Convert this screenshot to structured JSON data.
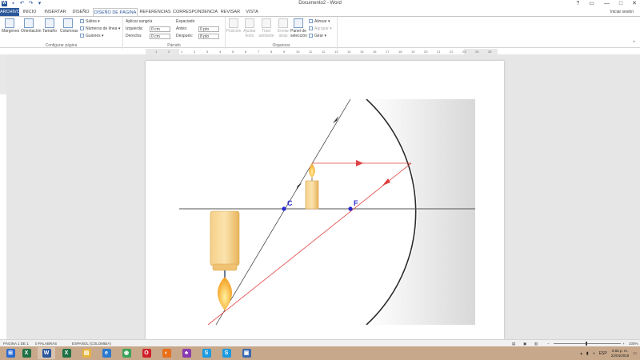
{
  "window": {
    "title": "Documento2 - Word",
    "sign_in": "Iniciar sesión",
    "help": "?",
    "restore": "▭",
    "minimize": "—",
    "maximize": "□",
    "close": "✕"
  },
  "quick_access": {
    "app_icon_label": "W",
    "save_icon": "save-icon",
    "undo_icon": "undo-icon",
    "redo_icon": "redo-icon",
    "customize_icon": "customize-icon"
  },
  "tabs": [
    {
      "label": "ARCHIVO"
    },
    {
      "label": "INICIO"
    },
    {
      "label": "INSERTAR"
    },
    {
      "label": "DISEÑO"
    },
    {
      "label": "DISEÑO DE PÁGINA"
    },
    {
      "label": "REFERENCIAS"
    },
    {
      "label": "CORRESPONDENCIA"
    },
    {
      "label": "REVISAR"
    },
    {
      "label": "VISTA"
    }
  ],
  "ribbon": {
    "page_setup": {
      "margins": "Márgenes",
      "orientation": "Orientación",
      "size": "Tamaño",
      "columns": "Columnas",
      "breaks": "Saltos",
      "line_numbers": "Números de línea",
      "hyphenation": "Guiones",
      "label": "Configurar página"
    },
    "paragraph": {
      "indent_header": "Aplicar sangría",
      "left_label": "Izquierda:",
      "left_value": "0 cm",
      "right_label": "Derecha:",
      "right_value": "0 cm",
      "spacing_header": "Espaciado",
      "before_label": "Antes:",
      "before_value": "0 pto",
      "after_label": "Después:",
      "after_value": "8 pto",
      "label": "Párrafo"
    },
    "arrange": {
      "position": "Posición",
      "wrap_text": "Ajustar texto",
      "bring_forward": "Traer adelante",
      "send_backward": "Enviar atrás",
      "selection_pane": "Panel de selección",
      "align": "Alinear",
      "group": "Agrupar",
      "rotate": "Girar",
      "label": "Organizar"
    }
  },
  "ruler": {
    "ticks": [
      "1",
      "2",
      "1",
      "2",
      "3",
      "4",
      "5",
      "6",
      "7",
      "8",
      "9",
      "10",
      "11",
      "12",
      "13",
      "14",
      "15",
      "16",
      "17",
      "18",
      "19",
      "20",
      "21",
      "22",
      "23",
      "24",
      "25"
    ]
  },
  "diagram": {
    "label_c": "C",
    "label_f": "F",
    "colors": {
      "mirror": "#2b2b2b",
      "axis": "#555555",
      "ray_red": "#e04040",
      "ray_dark": "#333333",
      "point": "#2a2ad0",
      "candle_body": "#f3c878",
      "candle_edge": "#d9a24a",
      "flame": "#f5a623"
    }
  },
  "statusbar": {
    "page": "PÁGINA 1 DE 1",
    "words": "0 PALABRAS",
    "language": "ESPAÑOL (COLOMBIA)",
    "zoom": "100%"
  },
  "taskbar": {
    "apps": [
      {
        "icon": "start-icon",
        "glyph": "⊞",
        "color": "#2a6ad0"
      },
      {
        "icon": "excel-icon",
        "glyph": "X",
        "color": "#1e7145"
      },
      {
        "icon": "word-icon",
        "glyph": "W",
        "color": "#2b579a"
      },
      {
        "icon": "excel-icon-2",
        "glyph": "X",
        "color": "#1e7145"
      },
      {
        "icon": "explorer-icon",
        "glyph": "▤",
        "color": "#e8b33a"
      },
      {
        "icon": "edge-icon",
        "glyph": "e",
        "color": "#2a7ad0"
      },
      {
        "icon": "chrome-icon",
        "glyph": "◉",
        "color": "#3aa35a"
      },
      {
        "icon": "opera-icon",
        "glyph": "O",
        "color": "#d0202a"
      },
      {
        "icon": "firefox-icon",
        "glyph": "◐",
        "color": "#e8701a"
      },
      {
        "icon": "media-icon",
        "glyph": "♣",
        "color": "#8a3ab0"
      },
      {
        "icon": "skype-icon",
        "glyph": "S",
        "color": "#1a9ae0"
      },
      {
        "icon": "skype-icon-2",
        "glyph": "S",
        "color": "#1a9ae0"
      },
      {
        "icon": "app-icon",
        "glyph": "▣",
        "color": "#3a6ab0"
      }
    ],
    "lang": "ESP",
    "time": "6:55 p. m.",
    "date": "22/04/2019"
  }
}
